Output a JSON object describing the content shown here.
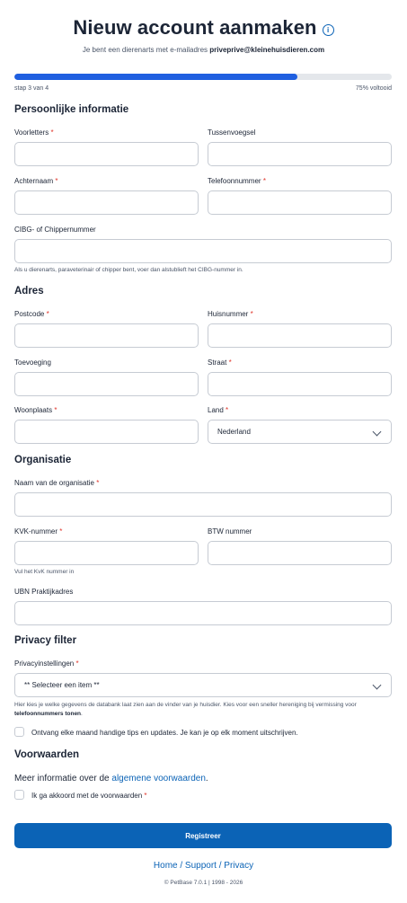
{
  "header": {
    "title": "Nieuw account aanmaken",
    "info_icon": "i",
    "subtitle_prefix": "Je bent een dierenarts met e-mailadres ",
    "email": "priveprive@kleinehuisdieren.com"
  },
  "progress": {
    "step_label": "stap 3 van 4",
    "percent_label": "75% voltooid",
    "fraction": 0.75
  },
  "sections": {
    "personal": "Persoonlijke informatie",
    "address": "Adres",
    "organisation": "Organisatie",
    "privacy": "Privacy filter",
    "terms": "Voorwaarden"
  },
  "fields": {
    "initials": "Voorletters",
    "infix": "Tussenvoegsel",
    "last_name": "Achternaam",
    "phone": "Telefoonnummer",
    "cibg": "CIBG- of Chippernummer",
    "cibg_hint": "Als u dierenarts, paraveterinair of chipper bent, voer dan alstublieft het CIBG-nummer in.",
    "postcode": "Postcode",
    "house_number": "Huisnummer",
    "addition": "Toevoeging",
    "street": "Straat",
    "city": "Woonplaats",
    "country": "Land",
    "country_value": "Nederland",
    "org_name": "Naam van de organisatie",
    "kvk": "KVK-nummer",
    "kvk_hint": "Vul het KvK nummer in",
    "vat": "BTW nummer",
    "ubn": "UBN Praktijkadres",
    "privacy_settings": "Privacyinstellingen",
    "privacy_value": "** Selecteer een item **",
    "privacy_hint": "Hier kies je welke gegevens de databank laat zien aan de vinder van je huisdier. Kies voor een sneller hereniging bij vermissing voor",
    "privacy_hint_bold": "telefoonnummers tonen",
    "privacy_hint_end": "."
  },
  "required_mark": "*",
  "newsletter_label": "Ontvang elke maand handige tips en updates. Je kan je op elk moment uitschrijven.",
  "terms": {
    "text": "Meer informatie over de ",
    "link": "algemene voorwaarden",
    "end": ".",
    "agree_label": "Ik ga akkoord met de voorwaarden"
  },
  "register_label": "Registreer",
  "footer": {
    "links": "Home / Support / Privacy",
    "copyright": "© PetBase 7.0.1 | 1998 - 2026"
  },
  "colors": {
    "accent": "#0b63b6",
    "progress": "#1f5fe0",
    "required": "#e0352b"
  }
}
